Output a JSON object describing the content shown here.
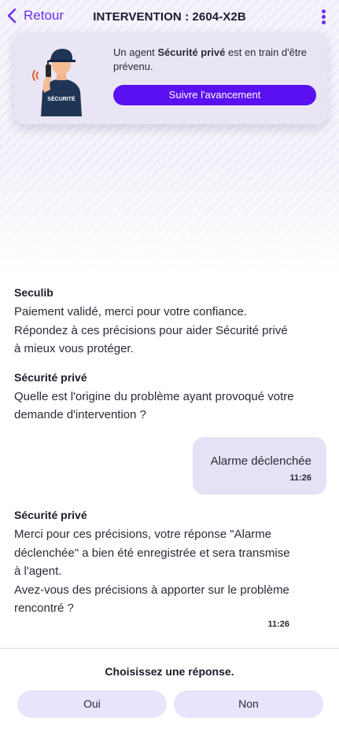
{
  "header": {
    "back_label": "Retour",
    "title": "INTERVENTION : 2604-X2B"
  },
  "status_card": {
    "text_before": "Un agent ",
    "agent_type": "Sécurité privé",
    "text_after": " est en train d'être prévenu.",
    "illustration_badge": "SÉCURITÉ",
    "track_button": "Suivre l'avancement"
  },
  "messages": [
    {
      "sender": "Seculib",
      "text": "Paiement validé, merci pour votre confiance.\nRépondez à ces précisions pour aider Sécurité privé à mieux vous protéger."
    },
    {
      "sender": "Sécurité privé",
      "text": "Quelle est l'origine du problème ayant provoqué votre demande d'intervention ?"
    },
    {
      "user_reply": "Alarme déclenchée",
      "time": "11:26"
    },
    {
      "sender": "Sécurité privé",
      "text": "Merci pour ces précisions, votre réponse \"Alarme déclenchée\" a bien été enregistrée et sera transmise à l'agent.\nAvez-vous des précisions à apporter sur le problème rencontré ?",
      "time": "11:26"
    }
  ],
  "footer": {
    "prompt": "Choisissez une réponse.",
    "options": [
      "Oui",
      "Non"
    ]
  },
  "colors": {
    "accent": "#5a10f0",
    "bubble": "#e6e1f5",
    "card": "#eae5f4"
  }
}
